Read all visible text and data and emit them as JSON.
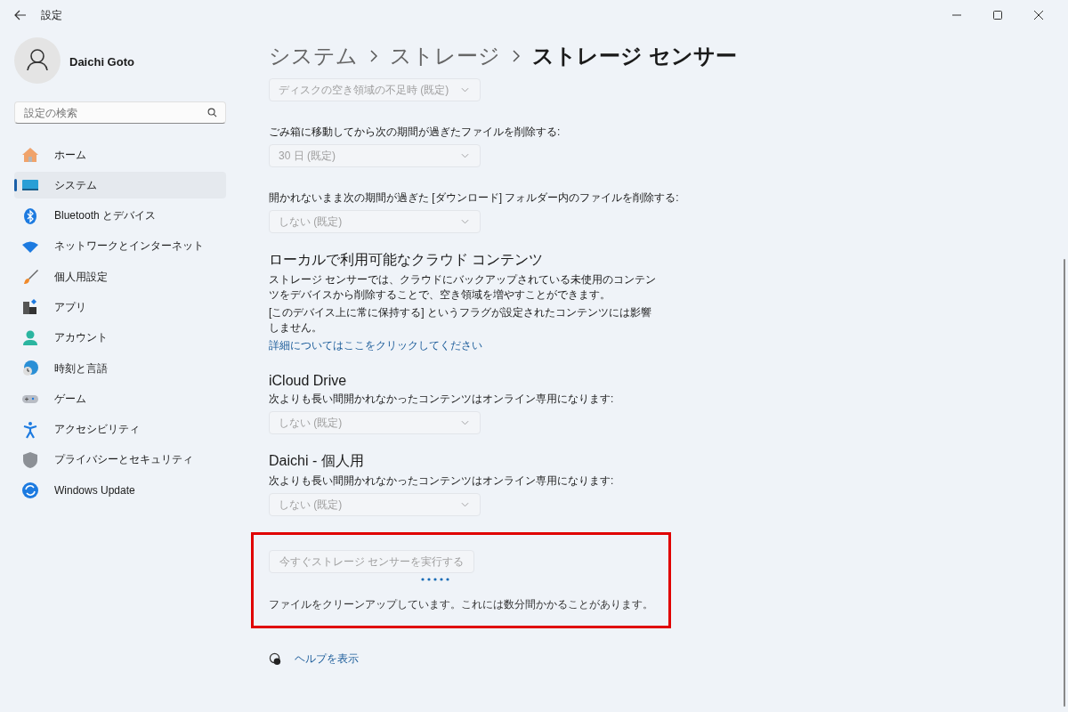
{
  "window": {
    "title": "設定"
  },
  "profile": {
    "name": "Daichi Goto"
  },
  "search": {
    "placeholder": "設定の検索"
  },
  "sidebar": {
    "items": [
      {
        "label": "ホーム",
        "selected": false
      },
      {
        "label": "システム",
        "selected": true
      },
      {
        "label": "Bluetooth とデバイス",
        "selected": false
      },
      {
        "label": "ネットワークとインターネット",
        "selected": false
      },
      {
        "label": "個人用設定",
        "selected": false
      },
      {
        "label": "アプリ",
        "selected": false
      },
      {
        "label": "アカウント",
        "selected": false
      },
      {
        "label": "時刻と言語",
        "selected": false
      },
      {
        "label": "ゲーム",
        "selected": false
      },
      {
        "label": "アクセシビリティ",
        "selected": false
      },
      {
        "label": "プライバシーとセキュリティ",
        "selected": false
      },
      {
        "label": "Windows Update",
        "selected": false
      }
    ]
  },
  "breadcrumb": [
    "システム",
    "ストレージ",
    "ストレージ センサー"
  ],
  "settings": [
    {
      "kind": "dropdown",
      "value": "ディスクの空き領域の不足時 (既定)",
      "disabled": true
    },
    {
      "kind": "label",
      "text": "ごみ箱に移動してから次の期間が過ぎたファイルを削除する:"
    },
    {
      "kind": "dropdown",
      "value": "30 日 (既定)",
      "disabled": true
    },
    {
      "kind": "label",
      "text": "開かれないまま次の期間が過ぎた [ダウンロード] フォルダー内のファイルを削除する:"
    },
    {
      "kind": "dropdown",
      "value": "しない (既定)",
      "disabled": true
    },
    {
      "kind": "heading",
      "text": "ローカルで利用可能なクラウド コンテンツ"
    },
    {
      "kind": "paragraph",
      "text": "ストレージ センサーでは、クラウドにバックアップされている未使用のコンテンツをデバイスから削除することで、空き領域を増やすことができます。"
    },
    {
      "kind": "paragraph",
      "text": "[このデバイス上に常に保持する] というフラグが設定されたコンテンツには影響しません。"
    },
    {
      "kind": "link",
      "text": "詳細についてはここをクリックしてください"
    },
    {
      "kind": "heading",
      "text": "iCloud Drive"
    },
    {
      "kind": "label",
      "text": "次よりも長い間開かれなかったコンテンツはオンライン専用になります:"
    },
    {
      "kind": "dropdown",
      "value": "しない (既定)",
      "disabled": true
    },
    {
      "kind": "heading",
      "text": "Daichi - 個人用"
    },
    {
      "kind": "label",
      "text": "次よりも長い間開かれなかったコンテンツはオンライン専用になります:"
    },
    {
      "kind": "dropdown",
      "value": "しない (既定)",
      "disabled": true
    }
  ],
  "run_section": {
    "button": {
      "label": "今すぐストレージ センサーを実行する",
      "disabled": true
    },
    "status": "ファイルをクリーンアップしています。これには数分間かかることがあります。"
  },
  "help_link": "ヘルプを表示"
}
